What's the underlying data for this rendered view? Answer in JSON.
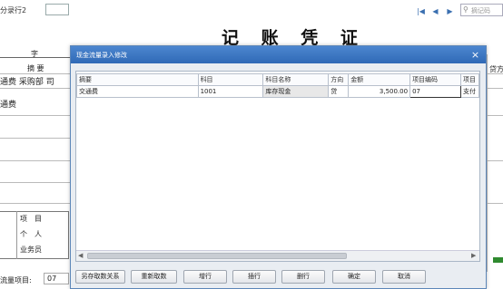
{
  "background": {
    "row_label": "分录行2",
    "search_placeholder": "摘记码",
    "voucher_title": "记 账 凭 证",
    "zi_label": "字",
    "summary_header": "摘 要",
    "row1_text": "通费  采购部  司",
    "row2_text": "通费",
    "side_labels": {
      "a": "项",
      "b": "目",
      "c": "个",
      "d": "人",
      "e": "业务员"
    },
    "cashflow_label": "流量项目:",
    "cashflow_value": "07",
    "right_label": "贷方"
  },
  "dialog": {
    "title": "现金流量录入修改",
    "close_label": "×",
    "columns": [
      "摘要",
      "科目",
      "科目名称",
      "方向",
      "金额",
      "项目编码",
      "项目"
    ],
    "rows": [
      [
        "交通费",
        "1001",
        "库存现金",
        "贷",
        "3,500.00",
        "07",
        "支付"
      ]
    ],
    "buttons": {
      "save_relation": "另存取数关系",
      "refetch": "重新取数",
      "add_row": "增行",
      "insert_row": "插行",
      "delete_row": "删行",
      "ok": "确定",
      "cancel": "取消"
    }
  },
  "colors": {
    "title_bar": "#2f69b6",
    "dialog_bg": "#e9edf2",
    "nav_icon": "#3a6fb0"
  }
}
